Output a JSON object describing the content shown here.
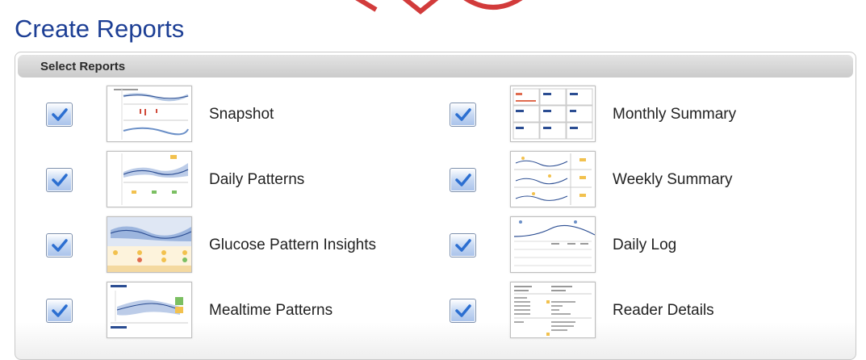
{
  "page": {
    "title": "Create Reports",
    "section_title": "Select Reports",
    "brand_color": "#1d3f95",
    "checkbox_check_color": "#2c6fd1"
  },
  "reports": [
    {
      "label": "Snapshot",
      "checked": true,
      "thumb": "snapshot"
    },
    {
      "label": "Monthly Summary",
      "checked": true,
      "thumb": "monthly"
    },
    {
      "label": "Daily Patterns",
      "checked": true,
      "thumb": "daily-patterns"
    },
    {
      "label": "Weekly Summary",
      "checked": true,
      "thumb": "weekly"
    },
    {
      "label": "Glucose Pattern Insights",
      "checked": true,
      "thumb": "glucose"
    },
    {
      "label": "Daily Log",
      "checked": true,
      "thumb": "daily-log"
    },
    {
      "label": "Mealtime Patterns",
      "checked": true,
      "thumb": "mealtime"
    },
    {
      "label": "Reader Details",
      "checked": true,
      "thumb": "reader"
    }
  ]
}
